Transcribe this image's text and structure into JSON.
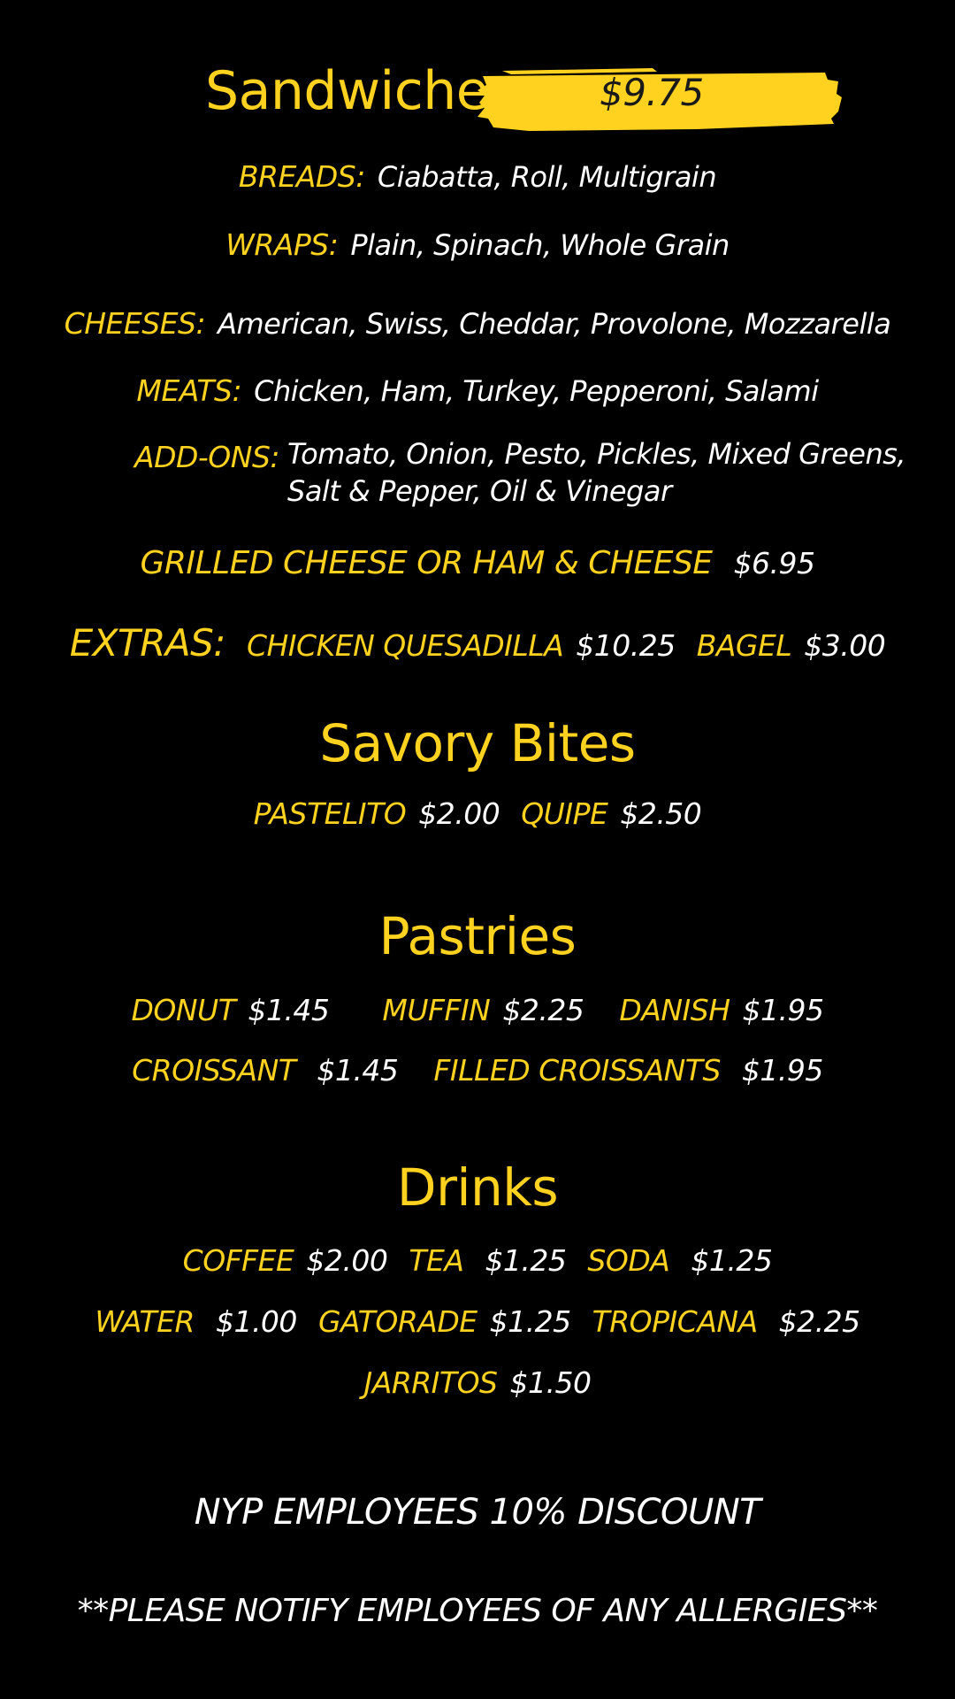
{
  "sandwiches": {
    "title": "Sandwiches",
    "price": "$9.75",
    "price_highlight_color": "#FFD21F",
    "breads": {
      "label": "BREADS:",
      "value": "Ciabatta, Roll, Multigrain"
    },
    "wraps": {
      "label": "WRAPS:",
      "value": "Plain, Spinach, Whole Grain"
    },
    "cheeses": {
      "label": "CHEESES:",
      "value": "American, Swiss, Cheddar, Provolone, Mozzarella"
    },
    "meats": {
      "label": "MEATS:",
      "value": "Chicken, Ham, Turkey, Pepperoni, Salami"
    },
    "addons": {
      "label": "ADD-ONS:",
      "line1": "Tomato, Onion, Pesto, Pickles, Mixed Greens,",
      "line2": "Salt & Pepper, Oil & Vinegar"
    },
    "grilled": {
      "name": "GRILLED CHEESE OR HAM & CHEESE",
      "price": "$6.95"
    },
    "extras": {
      "label": "EXTRAS:",
      "items": [
        {
          "name": "CHICKEN QUESADILLA",
          "price": "$10.25"
        },
        {
          "name": "BAGEL",
          "price": "$3.00"
        }
      ]
    }
  },
  "savory_bites": {
    "title": "Savory Bites",
    "items": [
      {
        "name": "PASTELITO",
        "price": "$2.00"
      },
      {
        "name": "QUIPE",
        "price": "$2.50"
      }
    ]
  },
  "pastries": {
    "title": "Pastries",
    "row1": [
      {
        "name": "DONUT",
        "price": "$1.45"
      },
      {
        "name": "MUFFIN",
        "price": "$2.25"
      },
      {
        "name": "DANISH",
        "price": "$1.95"
      }
    ],
    "row2": [
      {
        "name": "CROISSANT",
        "price": "$1.45"
      },
      {
        "name": "FILLED CROISSANTS",
        "price": "$1.95"
      }
    ]
  },
  "drinks": {
    "title": "Drinks",
    "row1": [
      {
        "name": "COFFEE",
        "price": "$2.00"
      },
      {
        "name": "TEA",
        "price": "$1.25"
      },
      {
        "name": "SODA",
        "price": "$1.25"
      }
    ],
    "row2": [
      {
        "name": "WATER",
        "price": "$1.00"
      },
      {
        "name": "GATORADE",
        "price": "$1.25"
      },
      {
        "name": "TROPICANA",
        "price": "$2.25"
      }
    ],
    "row3": [
      {
        "name": "JARRITOS",
        "price": "$1.50"
      }
    ]
  },
  "notices": {
    "discount": "NYP EMPLOYEES 10% DISCOUNT",
    "allergies": "**PLEASE NOTIFY EMPLOYEES OF ANY ALLERGIES**"
  },
  "colors": {
    "background": "#000000",
    "accent": "#FFD21F",
    "text": "#FFFFFF"
  }
}
